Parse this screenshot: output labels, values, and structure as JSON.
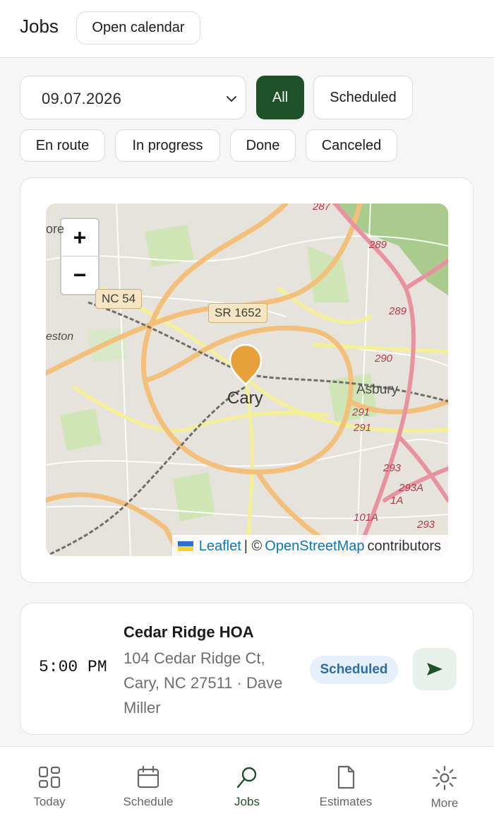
{
  "header": {
    "title": "Jobs",
    "calendar_button": "Open calendar"
  },
  "filters": {
    "date": "09.07.2026",
    "status_chips": [
      "All",
      "Scheduled",
      "En route",
      "In progress",
      "Done",
      "Canceled"
    ],
    "active_chip": "All"
  },
  "map": {
    "zoom_in": "+",
    "zoom_out": "−",
    "place_labels": [
      "Cary",
      "Asbury",
      "ore",
      "eston"
    ],
    "road_shields": [
      "NC 54",
      "SR 1652"
    ],
    "route_numbers": [
      "287",
      "289",
      "289",
      "290",
      "291",
      "291",
      "293",
      "293A",
      "1A",
      "101A",
      "293"
    ],
    "attribution": {
      "leaflet": "Leaflet",
      "separator": "| ©",
      "osm": "OpenStreetMap",
      "suffix": "contributors"
    },
    "colors": {
      "marker": "#e8a03a",
      "primary_road": "#f2c07a",
      "secondary_road": "#f5ef96",
      "interstate": "#e892a0",
      "park": "#cfe5b6"
    }
  },
  "jobs": [
    {
      "time": "5:00 PM",
      "name": "Cedar Ridge HOA",
      "address": "104 Cedar Ridge Ct, Cary, NC 27511 · Dave Miller",
      "status": "Scheduled",
      "action_icon": "navigate-icon"
    }
  ],
  "bottom_nav": [
    {
      "label": "Today",
      "icon": "grid-icon"
    },
    {
      "label": "Schedule",
      "icon": "calendar-icon"
    },
    {
      "label": "Jobs",
      "icon": "map-pin-icon",
      "active": true
    },
    {
      "label": "Estimates",
      "icon": "document-icon"
    },
    {
      "label": "More",
      "icon": "sun-icon"
    }
  ],
  "theme": {
    "brand": "#1e5128",
    "status_bg": "#e6f0fa",
    "status_text": "#2d6ca8"
  }
}
